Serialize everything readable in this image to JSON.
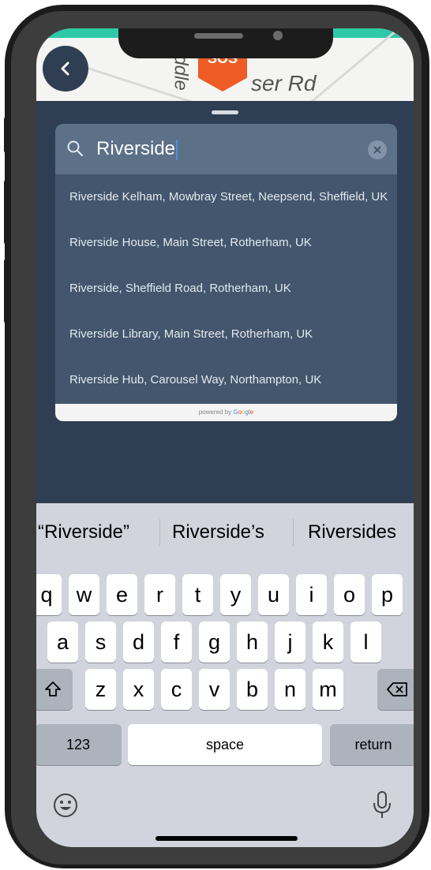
{
  "map": {
    "road_label_left": "ddle",
    "road_label_right": "ser Rd",
    "sos_label": "SOS"
  },
  "search": {
    "query": "Riverside"
  },
  "results": [
    "Riverside Kelham, Mowbray Street, Neepsend, Sheffield, UK",
    "Riverside House, Main Street, Rotherham, UK",
    "Riverside, Sheffield Road, Rotherham, UK",
    "Riverside Library, Main Street, Rotherham, UK",
    "Riverside Hub, Carousel Way, Northampton, UK"
  ],
  "attribution": {
    "powered_by": "powered by",
    "brand_letters": [
      "G",
      "o",
      "o",
      "g",
      "l",
      "e"
    ]
  },
  "keyboard": {
    "suggestions": [
      "“Riverside”",
      "Riverside’s",
      "Riversides"
    ],
    "row1": [
      "q",
      "w",
      "e",
      "r",
      "t",
      "y",
      "u",
      "i",
      "o",
      "p"
    ],
    "row2": [
      "a",
      "s",
      "d",
      "f",
      "g",
      "h",
      "j",
      "k",
      "l"
    ],
    "row3": [
      "z",
      "x",
      "c",
      "v",
      "b",
      "n",
      "m"
    ],
    "numbers_label": "123",
    "space_label": "space",
    "return_label": "return"
  },
  "colors": {
    "accent": "#2dc9a8",
    "sos": "#ef5b25",
    "sheet": "#2f3e52"
  },
  "icons": [
    "back-chevron-icon",
    "search-icon",
    "clear-icon",
    "shift-icon",
    "backspace-icon",
    "emoji-icon",
    "microphone-icon"
  ]
}
